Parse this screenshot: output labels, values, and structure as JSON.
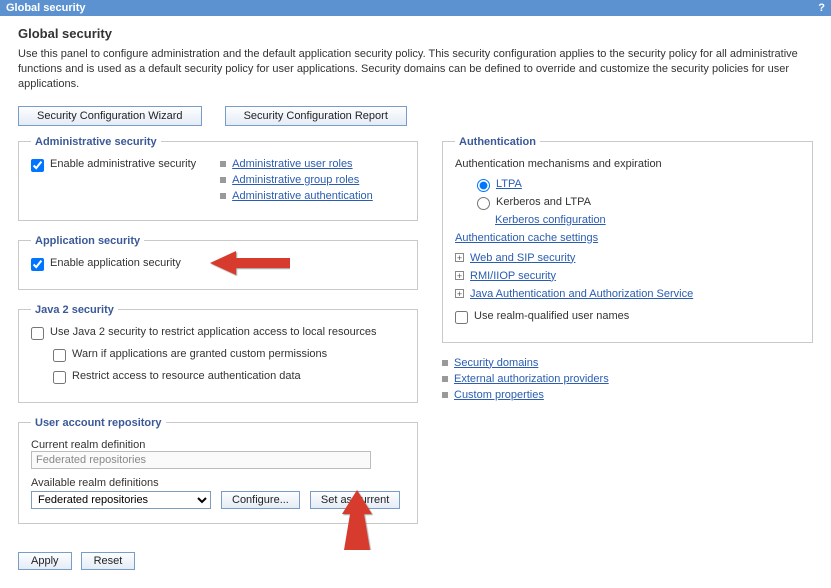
{
  "titlebar": {
    "title": "Global security"
  },
  "page": {
    "heading": "Global security",
    "intro": "Use this panel to configure administration and the default application security policy. This security configuration applies to the security policy for all administrative functions and is used as a default security policy for user applications. Security domains can be defined to override and customize the security policies for user applications."
  },
  "topButtons": {
    "wizard": "Security Configuration Wizard",
    "report": "Security Configuration Report"
  },
  "adminSecurity": {
    "legend": "Administrative security",
    "enableLabel": "Enable administrative security",
    "links": {
      "userRoles": "Administrative user roles",
      "groupRoles": "Administrative group roles",
      "auth": "Administrative authentication"
    }
  },
  "appSecurity": {
    "legend": "Application security",
    "enableLabel": "Enable application security"
  },
  "java2": {
    "legend": "Java 2 security",
    "useJava2": "Use Java 2 security to restrict application access to local resources",
    "warn": "Warn if applications are granted custom permissions",
    "restrict": "Restrict access to resource authentication data"
  },
  "repo": {
    "legend": "User account repository",
    "currentDefLabel": "Current realm definition",
    "currentDefValue": "Federated repositories",
    "availableLabel": "Available realm definitions",
    "options": [
      "Federated repositories"
    ],
    "configure": "Configure...",
    "setCurrent": "Set as current"
  },
  "auth": {
    "legend": "Authentication",
    "mechLabel": "Authentication mechanisms and expiration",
    "ltpa": "LTPA",
    "kerberosLtpa": "Kerberos and LTPA",
    "kerberosConfig": "Kerberos configuration",
    "cacheSettings": "Authentication cache settings",
    "webSip": "Web and SIP security",
    "rmi": "RMI/IIOP security",
    "jaas": "Java Authentication and Authorization Service",
    "useRealm": "Use realm-qualified user names"
  },
  "rightLinks": {
    "securityDomains": "Security domains",
    "externalAuth": "External authorization providers",
    "customProps": "Custom properties"
  },
  "bottomButtons": {
    "apply": "Apply",
    "reset": "Reset"
  }
}
